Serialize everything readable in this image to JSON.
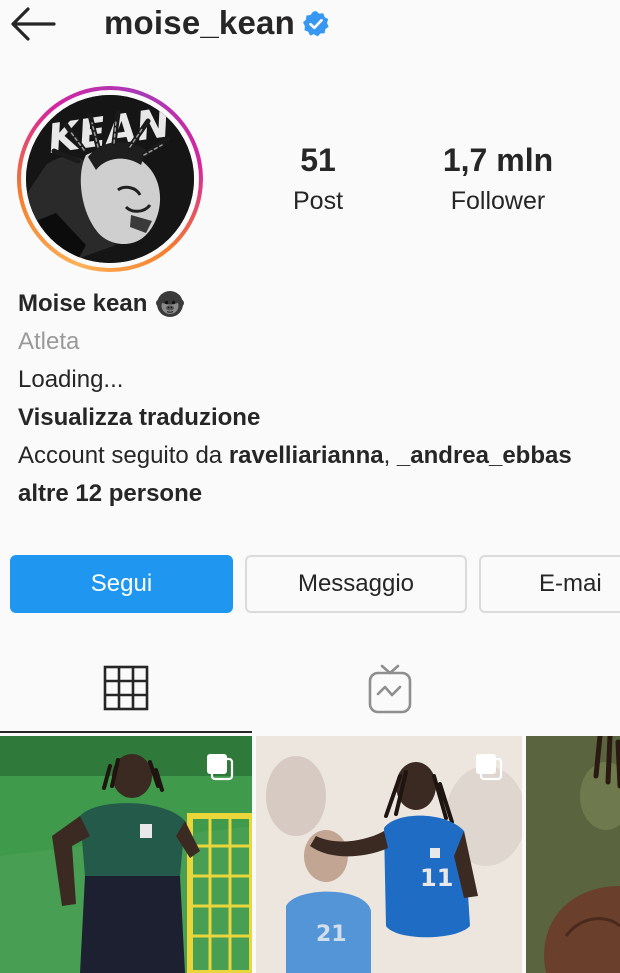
{
  "header": {
    "username": "moise_kean",
    "verified": true,
    "back_icon": "arrow-left-icon"
  },
  "profile": {
    "avatar_text": "KEAN",
    "stats": {
      "posts_count": "51",
      "posts_label": "Post",
      "followers_count": "1,7 mln",
      "followers_label": "Follower"
    },
    "name": "Moise kean",
    "name_emoji": "gorilla-icon",
    "category": "Atleta",
    "bio": "Loading...",
    "translate": "Visualizza traduzione",
    "followed_by_prefix": "Account seguito da ",
    "followed_by_user1": "ravelliarianna",
    "followed_by_sep": ", ",
    "followed_by_user2": "_andrea_ebbas",
    "followed_by_more": "altre 12 persone"
  },
  "actions": {
    "follow": "Segui",
    "message": "Messaggio",
    "email": "E-mai"
  },
  "tabs": {
    "grid_icon": "grid-icon",
    "igtv_icon": "igtv-icon",
    "active": "grid"
  },
  "colors": {
    "accent": "#1f97f1",
    "verified": "#3897f0",
    "text": "#262626",
    "muted": "#9a9a9a"
  }
}
